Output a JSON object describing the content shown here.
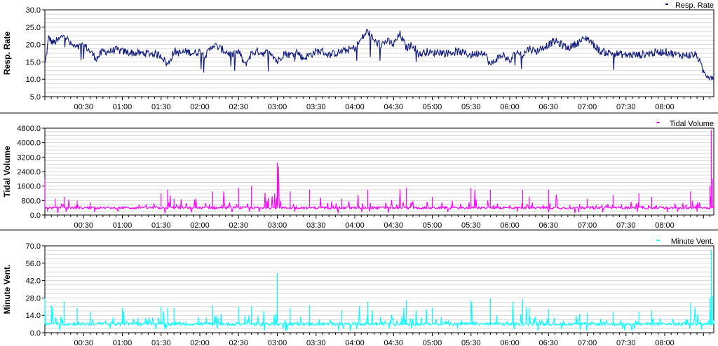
{
  "chart_data": [
    {
      "type": "line",
      "ylabel": "Resp. Rate",
      "legend": "Resp. Rate",
      "legend_placement": "top-right",
      "color": "#101a7a",
      "ylim": [
        5.0,
        30.0
      ],
      "yticks": [
        "5.0",
        "10.0",
        "15.0",
        "20.0",
        "25.0",
        "30.0"
      ],
      "xticks": [
        "00:30",
        "01:00",
        "01:30",
        "02:00",
        "02:30",
        "03:00",
        "03:30",
        "04:00",
        "04:30",
        "05:00",
        "05:30",
        "06:00",
        "06:30",
        "07:00",
        "07:30",
        "08:00"
      ],
      "x_start_min": 0,
      "x_end_min": 518,
      "series": [
        {
          "x": [
            0,
            3,
            6,
            10,
            15,
            20,
            25,
            30,
            35,
            40,
            45,
            50,
            55,
            60,
            70,
            80,
            90,
            95,
            100,
            105,
            110,
            115,
            120,
            125,
            130,
            135,
            140,
            145,
            150,
            155,
            160,
            165,
            170,
            175,
            180,
            185,
            190,
            195,
            200,
            205,
            210,
            215,
            220,
            225,
            230,
            235,
            240,
            245,
            250,
            255,
            260,
            265,
            270,
            275,
            280,
            285,
            290,
            295,
            300,
            305,
            310,
            320,
            330,
            340,
            345,
            350,
            355,
            360,
            365,
            370,
            375,
            380,
            385,
            390,
            395,
            400,
            405,
            410,
            415,
            420,
            425,
            430,
            440,
            450,
            460,
            470,
            480,
            490,
            495,
            500,
            505,
            510,
            514,
            518
          ],
          "y": [
            14,
            22,
            20.5,
            21,
            23,
            20,
            19,
            20,
            18,
            16,
            18,
            18,
            18.5,
            18,
            17.5,
            17.5,
            17,
            14,
            18,
            17.5,
            18,
            17.5,
            18,
            17,
            20,
            19,
            18,
            17,
            18,
            14,
            17.5,
            18,
            17.5,
            18,
            15,
            17.5,
            17,
            18,
            16,
            17,
            18,
            18,
            17,
            17.5,
            18,
            18.5,
            19,
            21.5,
            24,
            21,
            20,
            21,
            20,
            23,
            19,
            20,
            17,
            18,
            17.5,
            18,
            17.5,
            18,
            17,
            18,
            14,
            16,
            17,
            15,
            18,
            17,
            19,
            18,
            19,
            20,
            21,
            20,
            19,
            20,
            21,
            22,
            20,
            18,
            17.5,
            17,
            17,
            17.5,
            18,
            17,
            17,
            17,
            17,
            12,
            11,
            10.5
          ]
        }
      ]
    },
    {
      "type": "line",
      "ylabel": "Tidal Volume",
      "legend": "Tidal Volume",
      "legend_placement": "top-right",
      "color": "#ff00ff",
      "ylim": [
        0.0,
        4800.0
      ],
      "yticks": [
        "0.0",
        "800.0",
        "1600.0",
        "2400.0",
        "3200.0",
        "4000.0",
        "4800.0"
      ],
      "xticks": [
        "00:30",
        "01:00",
        "01:30",
        "02:00",
        "02:30",
        "03:00",
        "03:30",
        "04:00",
        "04:30",
        "05:00",
        "05:30",
        "06:00",
        "06:30",
        "07:00",
        "07:30",
        "08:00"
      ],
      "x_start_min": 0,
      "x_end_min": 518,
      "baseline": 400,
      "series": [
        {
          "x": [
            0,
            2,
            8,
            15,
            25,
            35,
            40,
            60,
            90,
            95,
            100,
            130,
            150,
            160,
            180,
            190,
            205,
            230,
            250,
            280,
            300,
            330,
            345,
            370,
            375,
            390,
            420,
            440,
            460,
            470,
            500,
            515,
            516,
            517,
            518
          ],
          "y": [
            2000,
            200,
            900,
            1000,
            800,
            700,
            400,
            350,
            1200,
            1400,
            900,
            1300,
            1500,
            1600,
            2900,
            1300,
            1400,
            900,
            1400,
            1500,
            1000,
            1500,
            1400,
            1400,
            1000,
            1400,
            900,
            1100,
            1200,
            1000,
            1300,
            1600,
            4700,
            2000,
            500
          ]
        }
      ]
    },
    {
      "type": "line",
      "ylabel": "Minute Vent.",
      "legend": "Minute Vent.",
      "legend_placement": "top-right",
      "color": "#00ffff",
      "ylim": [
        0.0,
        70.0
      ],
      "yticks": [
        "0.0",
        "14.0",
        "28.0",
        "42.0",
        "56.0",
        "70.0"
      ],
      "xticks": [
        "00:30",
        "01:00",
        "01:30",
        "02:00",
        "02:30",
        "03:00",
        "03:30",
        "04:00",
        "04:30",
        "05:00",
        "05:30",
        "06:00",
        "06:30",
        "07:00",
        "07:30",
        "08:00"
      ],
      "x_start_min": 0,
      "x_end_min": 518,
      "baseline": 7,
      "series": [
        {
          "x": [
            0,
            5,
            15,
            25,
            35,
            60,
            90,
            95,
            100,
            130,
            150,
            160,
            180,
            190,
            205,
            230,
            250,
            280,
            300,
            330,
            345,
            370,
            375,
            390,
            420,
            440,
            460,
            470,
            500,
            515,
            516,
            517,
            518
          ],
          "y": [
            28,
            22,
            25,
            20,
            17,
            20,
            21,
            20,
            20,
            22,
            21,
            21,
            48,
            20,
            22,
            18,
            25,
            26,
            20,
            26,
            28,
            27,
            20,
            19,
            16,
            17,
            17,
            18,
            24,
            28,
            67,
            30,
            10
          ]
        }
      ]
    }
  ]
}
